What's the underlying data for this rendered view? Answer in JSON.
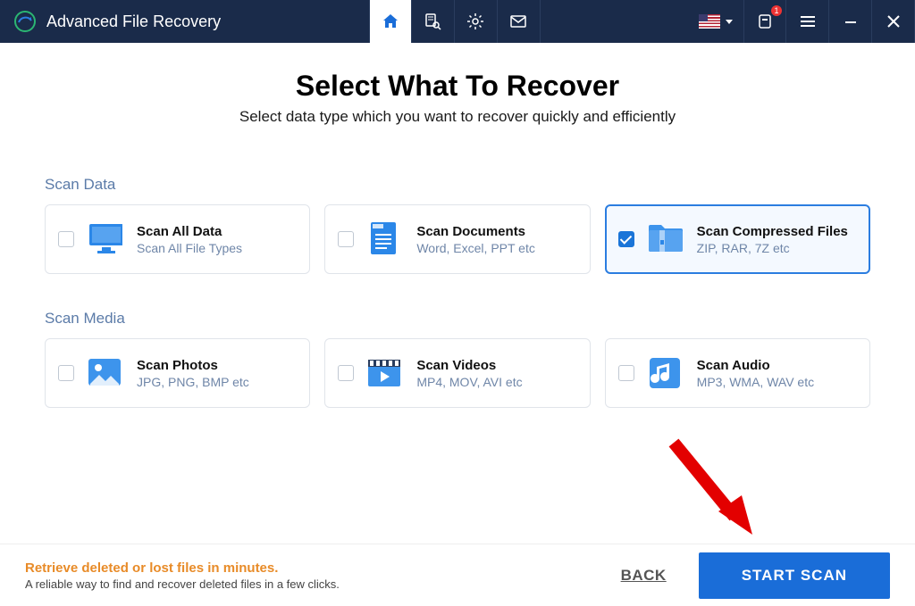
{
  "app": {
    "title": "Advanced File Recovery"
  },
  "titlebar_badge": "1",
  "main": {
    "title": "Select What To Recover",
    "subtitle": "Select data type which you want to recover quickly and efficiently"
  },
  "sections": {
    "data": {
      "label": "Scan Data",
      "cards": [
        {
          "title": "Scan All Data",
          "sub": "Scan All File Types",
          "checked": false
        },
        {
          "title": "Scan Documents",
          "sub": "Word, Excel, PPT etc",
          "checked": false
        },
        {
          "title": "Scan Compressed Files",
          "sub": "ZIP, RAR, 7Z etc",
          "checked": true
        }
      ]
    },
    "media": {
      "label": "Scan Media",
      "cards": [
        {
          "title": "Scan Photos",
          "sub": "JPG, PNG, BMP etc",
          "checked": false
        },
        {
          "title": "Scan Videos",
          "sub": "MP4, MOV, AVI etc",
          "checked": false
        },
        {
          "title": "Scan Audio",
          "sub": "MP3, WMA, WAV etc",
          "checked": false
        }
      ]
    }
  },
  "footer": {
    "promo": "Retrieve deleted or lost files in minutes.",
    "promo_sub": "A reliable way to find and recover deleted files in a few clicks.",
    "back": "BACK",
    "start": "START SCAN"
  }
}
